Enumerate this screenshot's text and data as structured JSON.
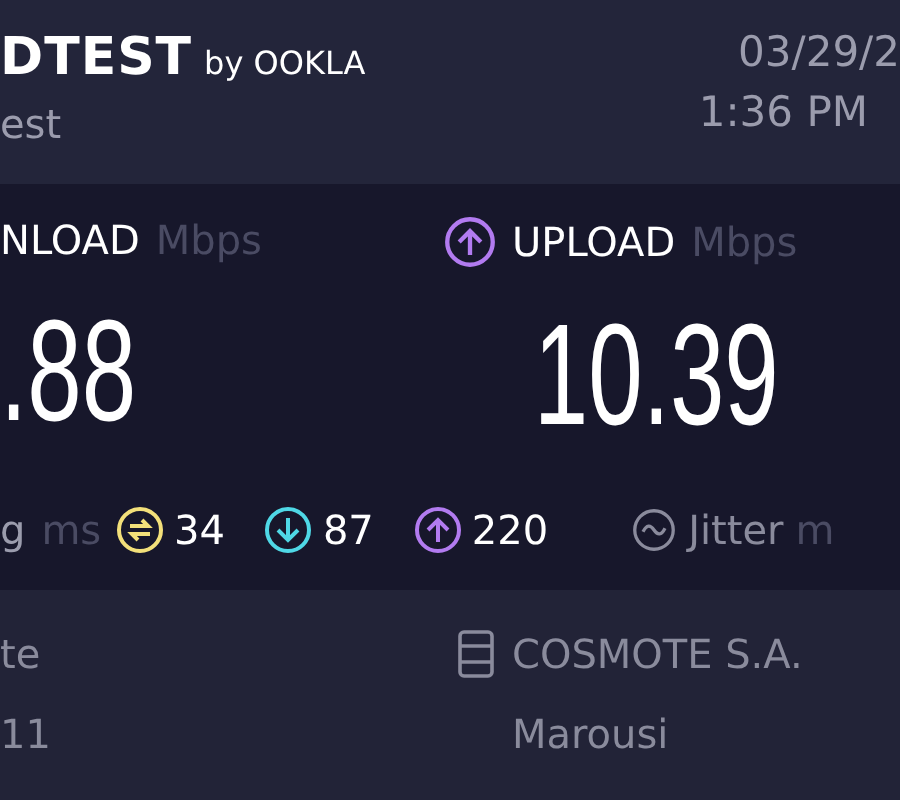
{
  "header": {
    "brand": "DTEST",
    "brand_suffix": "by OOKLA",
    "subtitle": "est",
    "date": "03/29/2",
    "time": "1:36 PM"
  },
  "results": [
    {
      "kind": "download",
      "label": "NLOAD",
      "unit": "Mbps",
      "value": ".88"
    },
    {
      "kind": "upload",
      "label": "UPLOAD",
      "unit": "Mbps",
      "value": "10.39"
    }
  ],
  "ping": {
    "label": "g",
    "unit": "ms",
    "metrics": [
      {
        "kind": "idle",
        "value": "34",
        "color": "#f3e07a"
      },
      {
        "kind": "download",
        "value": "87",
        "color": "#4fd8e6"
      },
      {
        "kind": "upload",
        "value": "220",
        "color": "#b27bf0"
      }
    ]
  },
  "jitter": {
    "label": "Jitter",
    "unit": "m"
  },
  "connection": {
    "left_line_1": "te",
    "left_line_2": "11",
    "provider": "COSMOTE S.A.",
    "location": "Marousi"
  }
}
